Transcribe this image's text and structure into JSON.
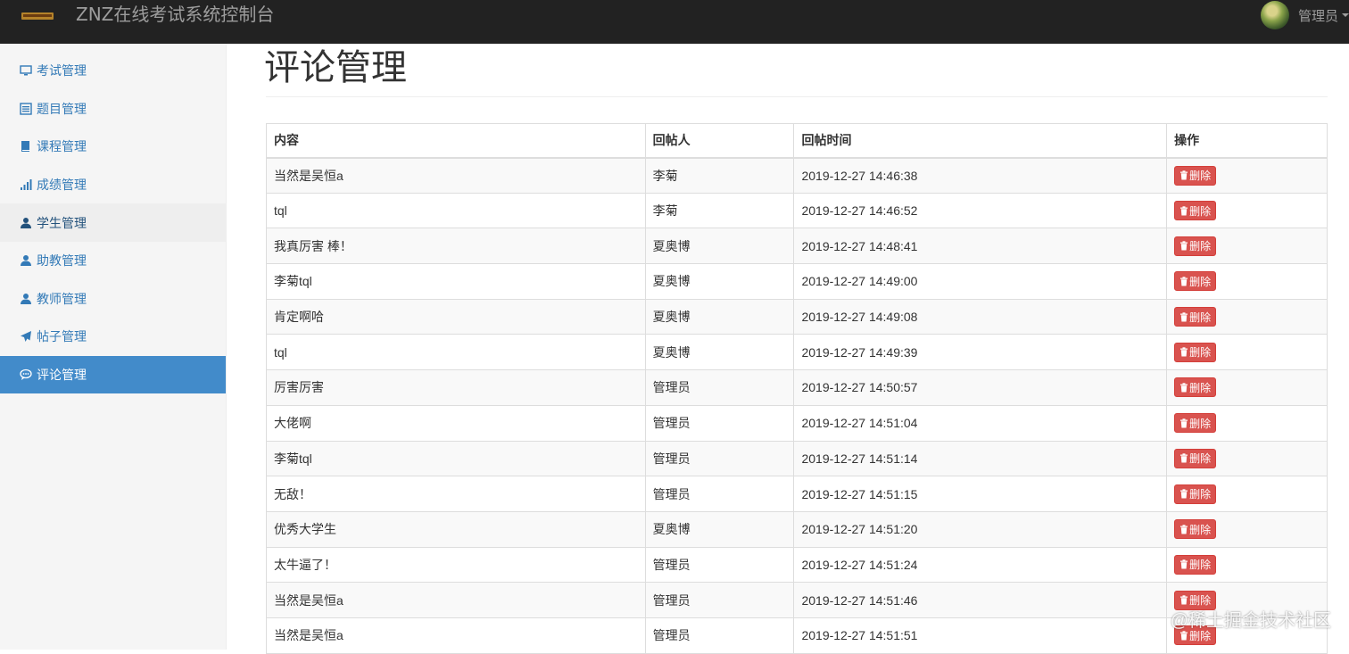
{
  "navbar": {
    "title": "ZNZ在线考试系统控制台",
    "user_name": "管理员"
  },
  "sidebar": {
    "items": [
      {
        "label": "考试管理",
        "icon": "monitor-icon"
      },
      {
        "label": "题目管理",
        "icon": "list-alt-icon"
      },
      {
        "label": "课程管理",
        "icon": "book-icon"
      },
      {
        "label": "成绩管理",
        "icon": "signal-icon"
      },
      {
        "label": "学生管理",
        "icon": "user-icon"
      },
      {
        "label": "助教管理",
        "icon": "user-icon"
      },
      {
        "label": "教师管理",
        "icon": "user-icon"
      },
      {
        "label": "帖子管理",
        "icon": "send-icon"
      },
      {
        "label": "评论管理",
        "icon": "comment-icon"
      }
    ],
    "active_index": 8,
    "hover_index": 4
  },
  "page": {
    "title": "评论管理"
  },
  "table": {
    "headers": {
      "content": "内容",
      "author": "回帖人",
      "time": "回帖时间",
      "operation": "操作"
    },
    "delete_label": "删除",
    "rows": [
      {
        "content": "当然是吴恒a",
        "author": "李菊",
        "time": "2019-12-27 14:46:38"
      },
      {
        "content": "tql",
        "author": "李菊",
        "time": "2019-12-27 14:46:52"
      },
      {
        "content": "我真厉害 棒！",
        "author": "夏奥博",
        "time": "2019-12-27 14:48:41"
      },
      {
        "content": "李菊tql",
        "author": "夏奥博",
        "time": "2019-12-27 14:49:00"
      },
      {
        "content": "肯定啊哈",
        "author": "夏奥博",
        "time": "2019-12-27 14:49:08"
      },
      {
        "content": "tql",
        "author": "夏奥博",
        "time": "2019-12-27 14:49:39"
      },
      {
        "content": "厉害厉害",
        "author": "管理员",
        "time": "2019-12-27 14:50:57"
      },
      {
        "content": "大佬啊",
        "author": "管理员",
        "time": "2019-12-27 14:51:04"
      },
      {
        "content": "李菊tql",
        "author": "管理员",
        "time": "2019-12-27 14:51:14"
      },
      {
        "content": "无敌！",
        "author": "管理员",
        "time": "2019-12-27 14:51:15"
      },
      {
        "content": "优秀大学生",
        "author": "夏奥博",
        "time": "2019-12-27 14:51:20"
      },
      {
        "content": "太牛逼了！",
        "author": "管理员",
        "time": "2019-12-27 14:51:24"
      },
      {
        "content": "当然是吴恒a",
        "author": "管理员",
        "time": "2019-12-27 14:51:46"
      },
      {
        "content": "当然是吴恒a",
        "author": "管理员",
        "time": "2019-12-27 14:51:51"
      }
    ]
  },
  "watermark": "@稀土掘金技术社区",
  "colors": {
    "navbar_bg": "#222222",
    "sidebar_bg": "#f5f5f5",
    "link": "#337ab7",
    "active_bg": "#428bca",
    "danger": "#d9534f"
  }
}
